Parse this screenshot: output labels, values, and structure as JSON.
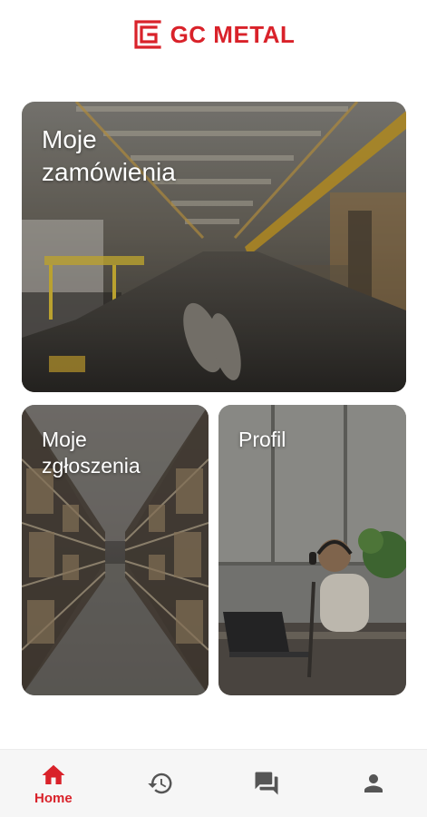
{
  "brand": {
    "name": "GC METAL",
    "color": "#d9222a"
  },
  "tiles": [
    {
      "label": "Moje\nzamówienia",
      "image": "factory-hall-photo"
    },
    {
      "label": "Moje\nzgłoszenia",
      "image": "warehouse-shelves-photo"
    },
    {
      "label": "Profil",
      "image": "person-at-laptop-photo"
    }
  ],
  "bottom_nav": {
    "active_color": "#d9222a",
    "inactive_color": "#555555",
    "items": [
      {
        "label": "Home",
        "icon": "home-icon",
        "active": true
      },
      {
        "label": "",
        "icon": "history-icon",
        "active": false
      },
      {
        "label": "",
        "icon": "chat-icon",
        "active": false
      },
      {
        "label": "",
        "icon": "person-icon",
        "active": false
      }
    ]
  }
}
